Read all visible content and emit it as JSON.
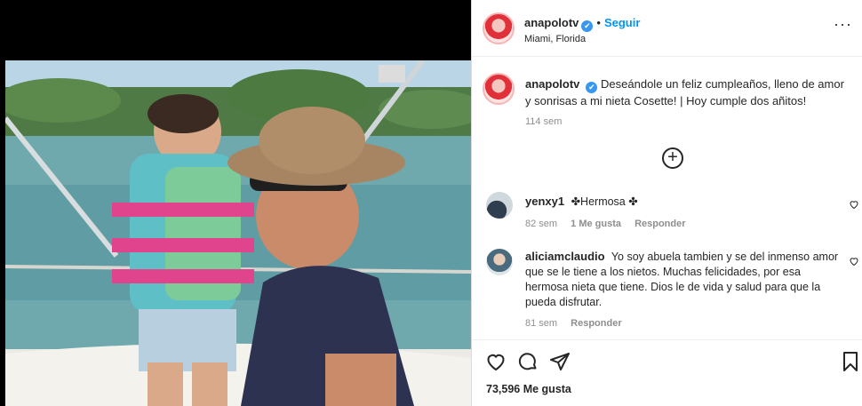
{
  "post": {
    "username": "anapolotv",
    "verified_mark": "✔",
    "dot": "•",
    "follow_label": "Seguir",
    "location": "Miami, Florida",
    "more_label": "···"
  },
  "caption": {
    "username": "anapolotv",
    "text": "Deseándole un feliz cumpleaños, lleno de amor y sonrisas a mi nieta Cosette! | Hoy cumple dos añitos!",
    "time": "114 sem"
  },
  "load_more": {
    "icon": "plus-circle-icon",
    "symbol": "+"
  },
  "comments": [
    {
      "username": "yenxy1",
      "text": "✤Hermosa ✤",
      "time": "82 sem",
      "likes": "1 Me gusta",
      "reply": "Responder"
    },
    {
      "username": "aliciamclaudio",
      "text": "Yo soy abuela tambien y se del inmenso amor que se le tiene a los nietos. Muchas felicidades, por esa hermosa nieta que tiene. Dios le de vida y salud para que la pueda disfrutar.",
      "time": "81 sem",
      "reply": "Responder"
    }
  ],
  "actions": {
    "icons": [
      "heart-icon",
      "comment-icon",
      "share-icon",
      "bookmark-icon"
    ],
    "likes_text": "73,596 Me gusta"
  },
  "colors": {
    "link": "#0095f6",
    "muted": "#8e8e8e",
    "text": "#262626",
    "verified": "#3897f0"
  }
}
